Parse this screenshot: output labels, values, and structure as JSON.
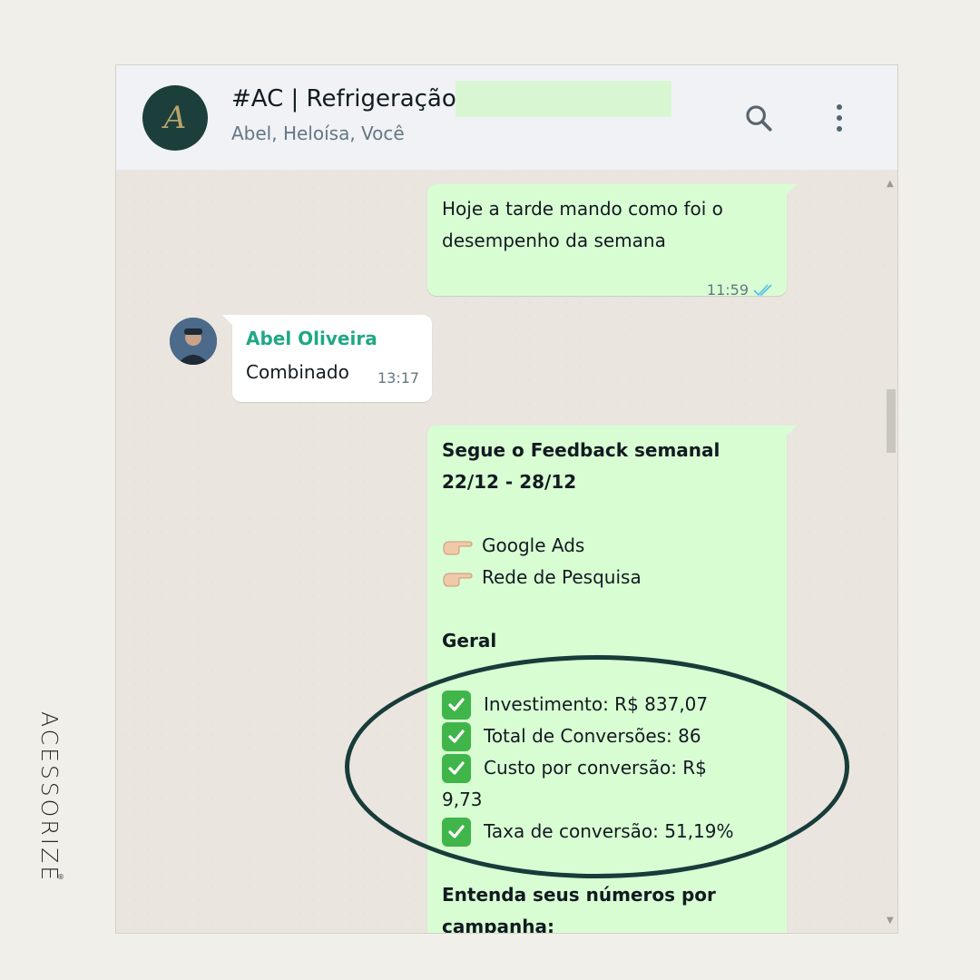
{
  "brand": {
    "name": "ACESSORIZE",
    "mark": "®"
  },
  "header": {
    "avatar_letter": "A",
    "title": "#AC | Refrigeração C",
    "subtitle": "Abel, Heloísa, Você",
    "search_icon": "search-icon",
    "menu_icon": "more-vertical-icon"
  },
  "messages": {
    "first": {
      "text": "Hoje a tarde mando como foi o desempenho da semana",
      "time": "11:59",
      "status_icon": "double-check-icon"
    },
    "second": {
      "sender": "Abel Oliveira",
      "text": "Combinado",
      "time": "13:17"
    },
    "third": {
      "title_line1": "Segue o Feedback semanal",
      "title_line2": "22/12 - 28/12",
      "bullet1": "Google Ads",
      "bullet2": "Rede de Pesquisa",
      "section": "Geral",
      "items": [
        "Investimento: R$ 837,07",
        "Total de Conversões: 86",
        "Custo por conversão: R$",
        "9,73",
        "Taxa de conversão: 51,19%"
      ],
      "footer_line1": "Entenda seus números por",
      "footer_line2": "campanha:"
    }
  },
  "colors": {
    "outgoing_bubble": "#d9fdd3",
    "incoming_bubble": "#ffffff",
    "sender_name": "#1fa885",
    "highlight_ring": "#173c39",
    "check_emoji": "#3fb54a"
  }
}
